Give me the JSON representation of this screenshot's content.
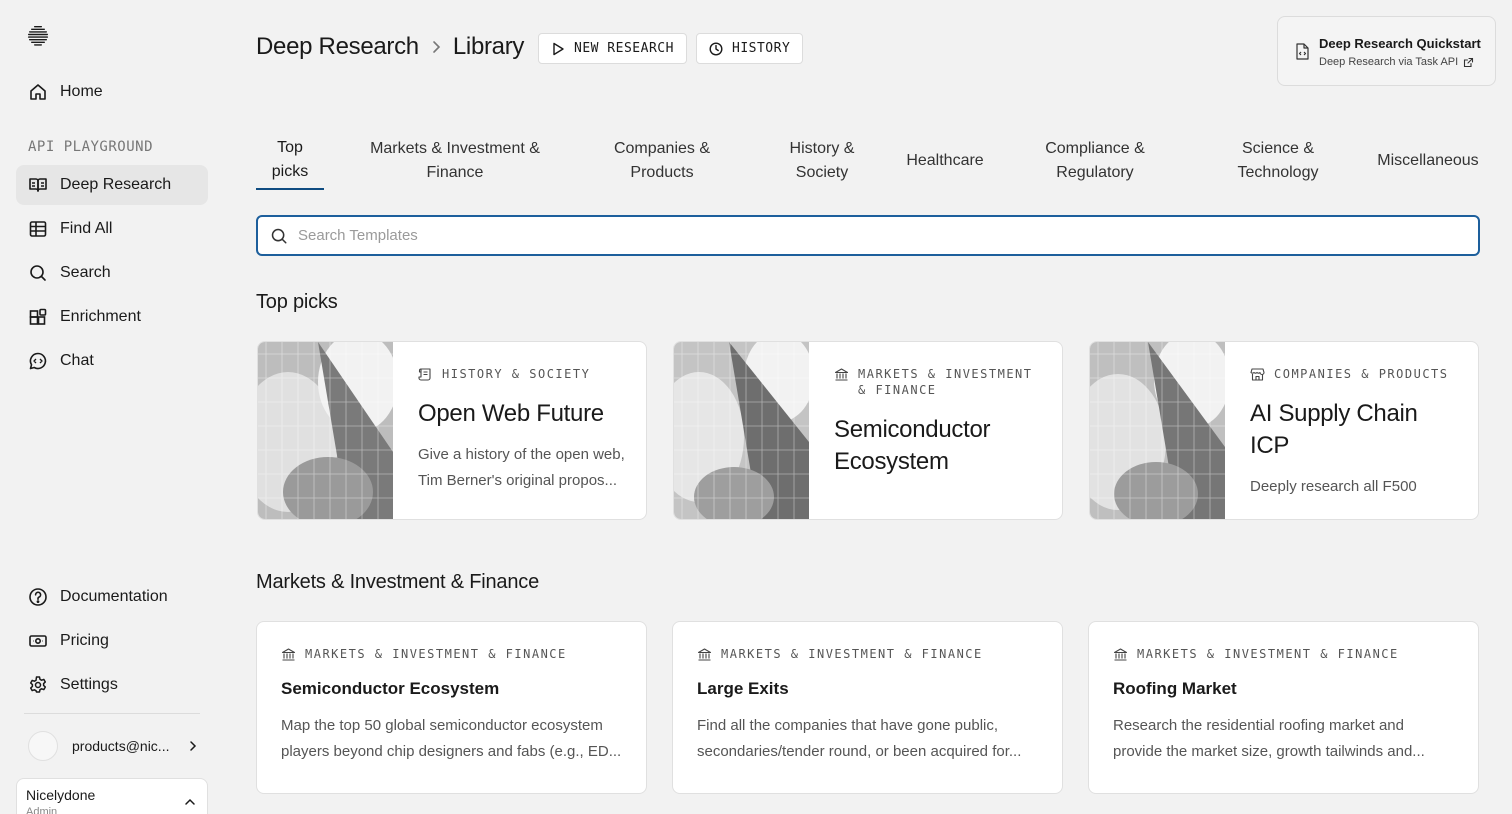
{
  "sidebar": {
    "nav": [
      {
        "label": "Home",
        "icon": "home-icon"
      },
      {
        "label": "Deep Research",
        "icon": "book-icon"
      },
      {
        "label": "Find All",
        "icon": "table-icon"
      },
      {
        "label": "Search",
        "icon": "search-icon"
      },
      {
        "label": "Enrichment",
        "icon": "enrichment-icon"
      },
      {
        "label": "Chat",
        "icon": "chat-icon"
      },
      {
        "label": "Documentation",
        "icon": "help-icon"
      },
      {
        "label": "Pricing",
        "icon": "pricing-icon"
      },
      {
        "label": "Settings",
        "icon": "gear-icon"
      }
    ],
    "section_label": "API PLAYGROUND",
    "user_email": "products@nic...",
    "org_name": "Nicelydone",
    "org_role": "Admin"
  },
  "header": {
    "crumb_root": "Deep Research",
    "crumb_current": "Library",
    "new_research_label": "NEW RESEARCH",
    "history_label": "HISTORY",
    "quickstart_title": "Deep Research Quickstart",
    "quickstart_sub": "Deep Research via Task API"
  },
  "tabs": [
    {
      "label": "Top\npicks"
    },
    {
      "label": "Markets & Investment &\nFinance"
    },
    {
      "label": "Companies &\nProducts"
    },
    {
      "label": "History &\nSociety"
    },
    {
      "label": "Healthcare"
    },
    {
      "label": "Compliance &\nRegulatory"
    },
    {
      "label": "Science &\nTechnology"
    },
    {
      "label": "Miscellaneous"
    }
  ],
  "search": {
    "placeholder": "Search Templates"
  },
  "top_picks": {
    "title": "Top picks",
    "cards": [
      {
        "category": "HISTORY & SOCIETY",
        "title": "Open Web Future",
        "desc": "Give a history of the open web, Tim Berner's original propos..."
      },
      {
        "category": "MARKETS & INVESTMENT & FINANCE",
        "title": "Semiconductor Ecosystem",
        "desc": ""
      },
      {
        "category": "COMPANIES & PRODUCTS",
        "title": "AI Supply Chain ICP",
        "desc": "Deeply research all F500"
      }
    ]
  },
  "markets": {
    "title": "Markets & Investment & Finance",
    "cards": [
      {
        "category": "MARKETS & INVESTMENT & FINANCE",
        "title": "Semiconductor Ecosystem",
        "desc": "Map the top 50 global semiconductor ecosystem players beyond chip designers and fabs (e.g., ED..."
      },
      {
        "category": "MARKETS & INVESTMENT & FINANCE",
        "title": "Large Exits",
        "desc": "Find all the companies that have gone public, secondaries/tender round, or been acquired for..."
      },
      {
        "category": "MARKETS & INVESTMENT & FINANCE",
        "title": "Roofing Market",
        "desc": "Research the residential roofing market and provide the market size, growth tailwinds and..."
      }
    ]
  },
  "colors": {
    "accent": "#0f4c81",
    "search_border": "#1d5f9c",
    "background": "#f2f2f2"
  }
}
